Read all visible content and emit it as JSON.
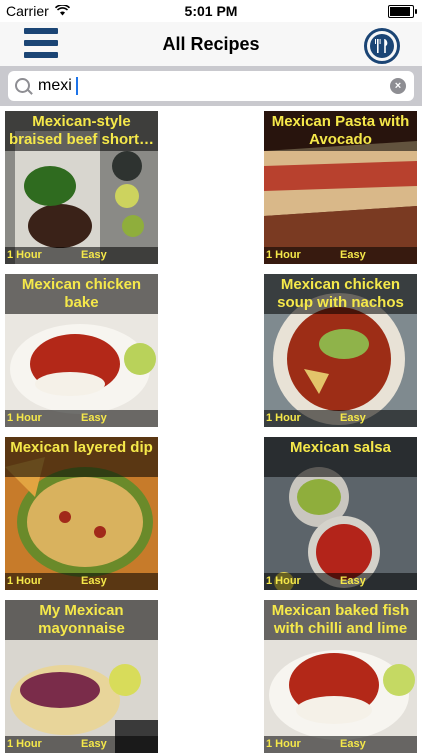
{
  "status": {
    "carrier": "Carrier",
    "time": "5:01 PM",
    "battery_level": 0.9
  },
  "nav": {
    "title": "All Recipes",
    "menu_icon": "hamburger-menu-icon",
    "utensils_icon": "plate-fork-knife-icon"
  },
  "search": {
    "value": "mexi",
    "clear_icon": "clear-x-icon"
  },
  "recipes": [
    {
      "title": "Mexican-style braised beef short…",
      "time": "1 Hour",
      "difficulty": "Easy",
      "photo": "braised-beef-photo"
    },
    {
      "title": "Mexican Pasta with Avocado",
      "time": "1 Hour",
      "difficulty": "Easy",
      "photo": "pasta-avocado-photo"
    },
    {
      "title": "Mexican chicken bake",
      "time": "1 Hour",
      "difficulty": "Easy",
      "photo": "chicken-bake-photo"
    },
    {
      "title": "Mexican chicken soup with nachos",
      "time": "1 Hour",
      "difficulty": "Easy",
      "photo": "chicken-soup-photo"
    },
    {
      "title": "Mexican layered dip",
      "time": "1 Hour",
      "difficulty": "Easy",
      "photo": "layered-dip-photo"
    },
    {
      "title": "Mexican salsa",
      "time": "1 Hour",
      "difficulty": "Easy",
      "photo": "salsa-photo"
    },
    {
      "title": "My Mexican mayonnaise",
      "time": "1 Hour",
      "difficulty": "Easy",
      "photo": "mayonnaise-tacos-photo"
    },
    {
      "title": "Mexican baked fish with chilli and lime",
      "time": "1 Hour",
      "difficulty": "Easy",
      "photo": "baked-fish-photo"
    }
  ]
}
